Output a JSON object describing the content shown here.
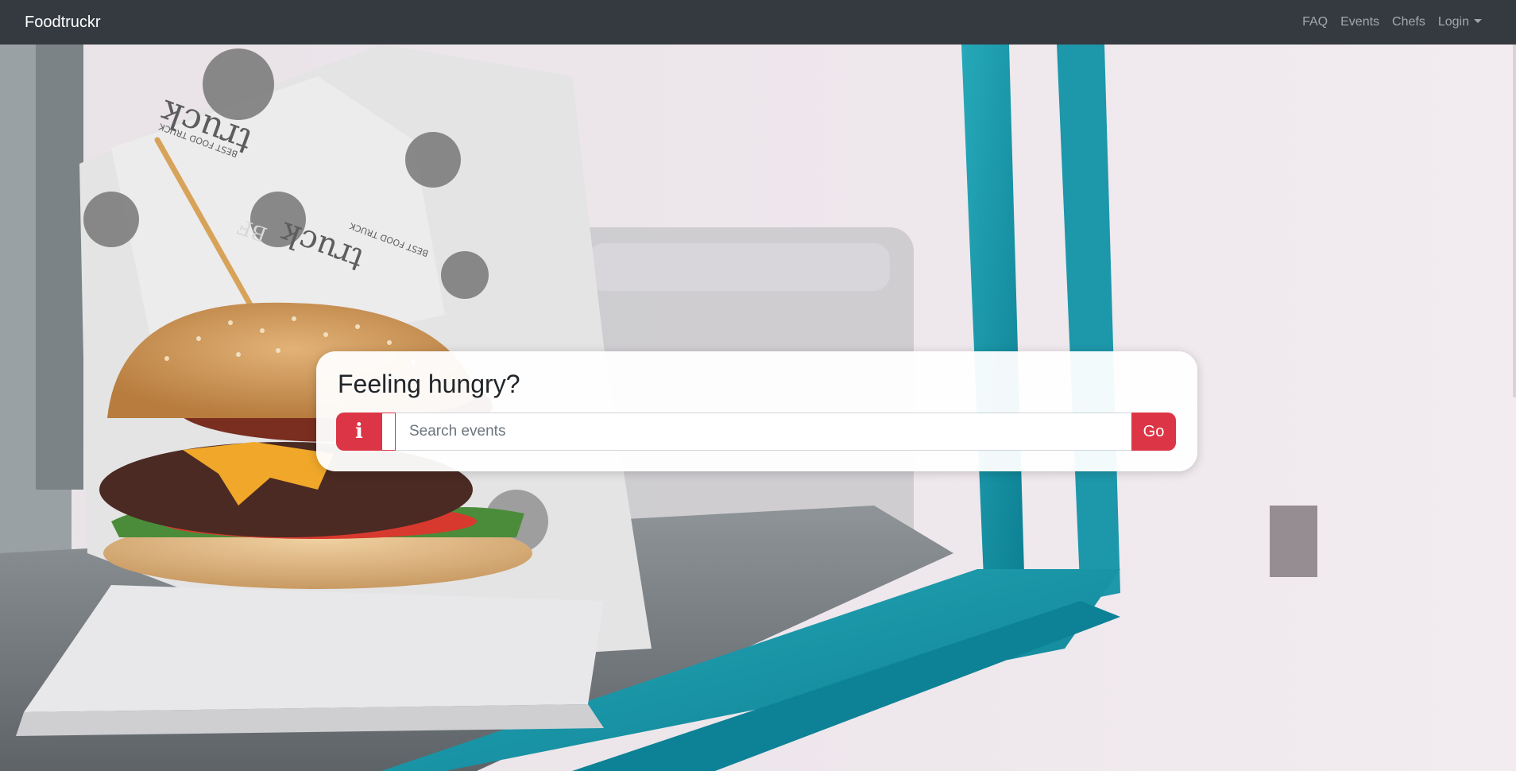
{
  "navbar": {
    "brand": "Foodtruckr",
    "links": [
      "FAQ",
      "Events",
      "Chefs"
    ],
    "login_label": "Login"
  },
  "hero": {
    "image_description": "burger-in-food-truck-window",
    "wrapper_text_1": "truck",
    "wrapper_text_2": "BEST FOOD TRUCK",
    "wrapper_text_3": "BF"
  },
  "search": {
    "title": "Feeling hungry?",
    "info_icon": "info-icon",
    "placeholder": "Search events",
    "value": "",
    "go_label": "Go"
  },
  "colors": {
    "navbar_bg": "#343a40",
    "accent": "#dc3545",
    "window_frame": "#1fa3b4"
  }
}
